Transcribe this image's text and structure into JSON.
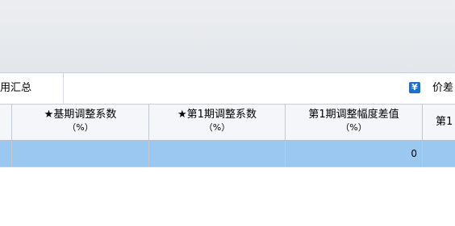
{
  "toolbar": {
    "summary_label": "用汇总",
    "price_icon": "yen-icon",
    "price_label": "价差"
  },
  "table": {
    "headers": [
      {
        "line1": "★基期调整系数",
        "line2": "（%）"
      },
      {
        "line1": "★第1期调整系数",
        "line2": "（%）"
      },
      {
        "line1": "第1期调整幅度差值",
        "line2": "（%）"
      },
      {
        "line1": "第1",
        "line2": ""
      }
    ],
    "rows": [
      {
        "cells": [
          "",
          "",
          "",
          "0",
          ""
        ]
      }
    ]
  },
  "colors": {
    "selected_row": "#9ac8f1",
    "header_bg": "#f4f6f9",
    "icon_blue": "#1e6fd0"
  }
}
